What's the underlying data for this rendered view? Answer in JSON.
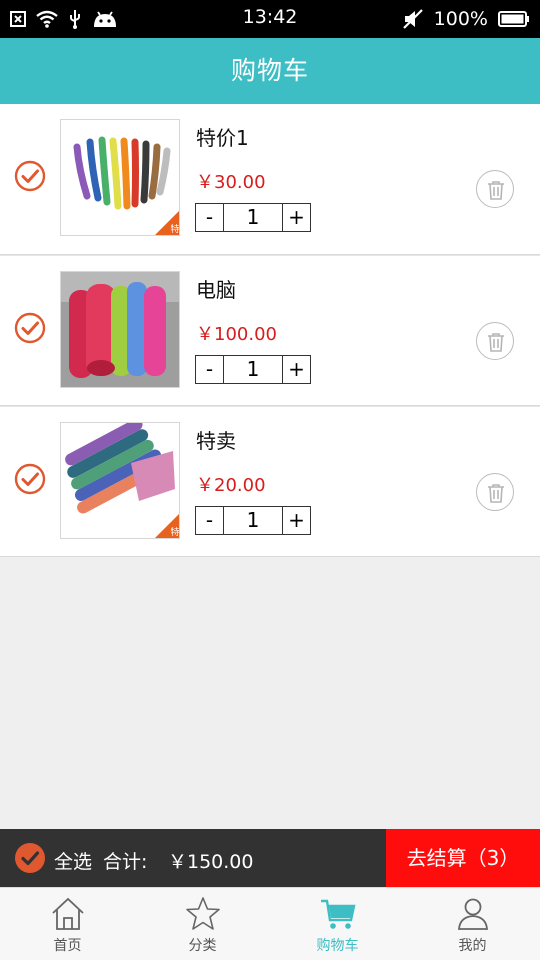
{
  "status_bar": {
    "time": "13:42",
    "battery": "100%",
    "icons": [
      "notification-box-icon",
      "wifi-icon",
      "usb-icon",
      "android-icon",
      "mute-icon",
      "battery-icon"
    ]
  },
  "header": {
    "title": "购物车"
  },
  "cart": {
    "items": [
      {
        "name": "特价1",
        "price": "￥30.00",
        "quantity": "1",
        "checked": true,
        "badge": "特",
        "image": "colorful-tubes"
      },
      {
        "name": "电脑",
        "price": "￥100.00",
        "quantity": "1",
        "checked": true,
        "badge": "",
        "image": "rolled-foam-mats"
      },
      {
        "name": "特卖",
        "price": "￥20.00",
        "quantity": "1",
        "checked": true,
        "badge": "特",
        "image": "yoga-mats"
      }
    ],
    "minus_label": "-",
    "plus_label": "+"
  },
  "checkout": {
    "select_all_label": "全选",
    "total_label": "合计:",
    "total_value": "￥150.00",
    "button_label": "去结算（3）"
  },
  "tabs": [
    {
      "label": "首页",
      "icon": "home-icon",
      "active": false
    },
    {
      "label": "分类",
      "icon": "star-icon",
      "active": false
    },
    {
      "label": "购物车",
      "icon": "cart-icon",
      "active": true
    },
    {
      "label": "我的",
      "icon": "user-icon",
      "active": false
    }
  ],
  "colors": {
    "accent": "#3dbec4",
    "price": "#d71d1d",
    "check": "#e0582f",
    "checkout_button": "#ff0d0d",
    "checkout_bar": "#323232"
  }
}
